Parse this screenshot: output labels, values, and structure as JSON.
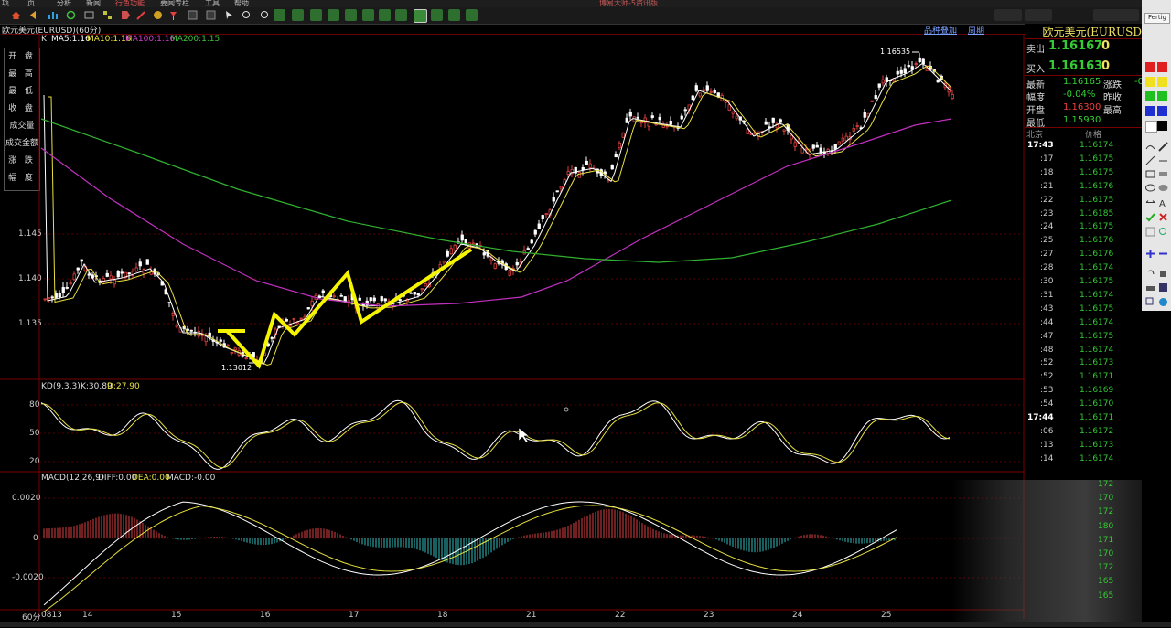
{
  "menubar": {
    "items": [
      "项",
      "页",
      "分析",
      "新闻",
      "行色功能",
      "要闻专栏",
      "工具",
      "帮助"
    ],
    "center_title": "博易大师-5资讯版"
  },
  "chart": {
    "instrument_label": "欧元美元(EURUSD)(60分)",
    "links": {
      "overlay": "品种叠加",
      "period": "周期"
    },
    "ma_label": "K",
    "ma": [
      {
        "name": "MA5:1.16",
        "color": "#ffffff"
      },
      {
        "name": "MA10:1.16",
        "color": "#e8e040"
      },
      {
        "name": "MA100:1.16",
        "color": "#d040d0"
      },
      {
        "name": "MA200:1.15",
        "color": "#40c040"
      }
    ],
    "high_annotation": "1.16535",
    "low_annotation": "1.13012",
    "price_ticks": [
      "1.145",
      "1.140",
      "1.135"
    ],
    "left_tools": [
      "开 盘",
      "最 高",
      "最 低",
      "收 盘",
      "成交量",
      "成交金额",
      "涨 跌",
      "幅 度"
    ]
  },
  "kd": {
    "label": "KD(9,3,3)",
    "k_label": "K:30.89",
    "d_label": "D:27.90",
    "ticks": [
      "80",
      "50",
      "20"
    ]
  },
  "macd": {
    "label": "MACD(12,26,9)",
    "diff_label": "DIFF:0.00",
    "dea_label": "DEA:0.00",
    "macd_label": "MACD:-0.00",
    "ticks": [
      "0.0020",
      "0",
      "-0.0020"
    ]
  },
  "xaxis": {
    "period_tag": "60分",
    "start_tag": "0813",
    "days": [
      "14",
      "15",
      "16",
      "17",
      "18",
      "21",
      "22",
      "23",
      "24",
      "25"
    ]
  },
  "quote": {
    "title": "欧元美元(EURUSD",
    "sell_label": "卖出",
    "sell_value": "1.16167",
    "sell_qty": "0",
    "buy_label": "买入",
    "buy_value": "1.16163",
    "buy_qty": "0",
    "latest_label": "最新",
    "latest_value": "1.16165",
    "change_label": "涨跌",
    "change_value": "-0",
    "range_label": "幅度",
    "range_value": "-0.04%",
    "prev_label": "昨收",
    "open_label": "开盘",
    "open_value": "1.16300",
    "high_label": "最高",
    "low_label": "最低",
    "low_value": "1.15930",
    "col_time": "北京",
    "col_price": "价格",
    "ticks": [
      {
        "time": "17:43",
        "price": "1.16174"
      },
      {
        "time": ":17",
        "price": "1.16175"
      },
      {
        "time": ":18",
        "price": "1.16175"
      },
      {
        "time": ":21",
        "price": "1.16176"
      },
      {
        "time": ":22",
        "price": "1.16175"
      },
      {
        "time": ":23",
        "price": "1.16185"
      },
      {
        "time": ":24",
        "price": "1.16175"
      },
      {
        "time": ":25",
        "price": "1.16176"
      },
      {
        "time": ":27",
        "price": "1.16176"
      },
      {
        "time": ":28",
        "price": "1.16174"
      },
      {
        "time": ":30",
        "price": "1.16175"
      },
      {
        "time": ":31",
        "price": "1.16174"
      },
      {
        "time": ":43",
        "price": "1.16175"
      },
      {
        "time": ":44",
        "price": "1.16174"
      },
      {
        "time": ":47",
        "price": "1.16175"
      },
      {
        "time": ":48",
        "price": "1.16174"
      },
      {
        "time": ":52",
        "price": "1.16173"
      },
      {
        "time": ":52",
        "price": "1.16171"
      },
      {
        "time": ":53",
        "price": "1.16169"
      },
      {
        "time": ":54",
        "price": "1.16170"
      },
      {
        "time": "17:44",
        "price": "1.16171"
      },
      {
        "time": ":06",
        "price": "1.16172"
      },
      {
        "time": ":13",
        "price": "1.16173"
      },
      {
        "time": ":14",
        "price": "1.16174"
      }
    ],
    "lower_prices": [
      "172",
      "170",
      "172",
      "180",
      "171",
      "170",
      "172",
      "165",
      "165"
    ]
  },
  "drawing_panel": {
    "title": "Fertig"
  }
}
